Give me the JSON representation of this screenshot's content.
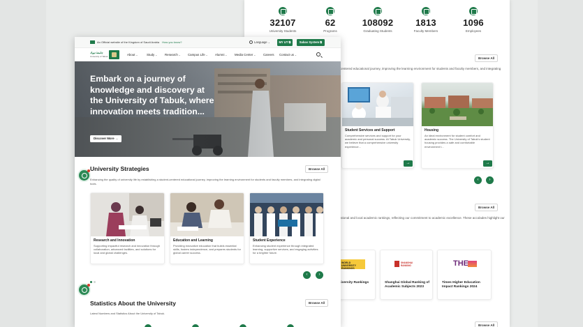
{
  "back_window": {
    "stats": [
      {
        "number": "32107",
        "label": "University Students",
        "icon": "graduation-cap-icon"
      },
      {
        "number": "62",
        "label": "Programs",
        "icon": "book-icon"
      },
      {
        "number": "108092",
        "label": "Graduating Students",
        "icon": "diploma-icon"
      },
      {
        "number": "1813",
        "label": "Faculty Members",
        "icon": "teacher-icon"
      },
      {
        "number": "1096",
        "label": "Employees",
        "icon": "briefcase-icon"
      }
    ],
    "browse_all_1": "Browse All",
    "intro_text": "centered educational journey, improving the learning environment for students and faculty members, and integrating",
    "cards": [
      {
        "title": "Student Services and Support",
        "description": "Comprehensive services and support for your academic and personal success. At Tabuk University, we believe that a comprehensive university experience..."
      },
      {
        "title": "Housing",
        "description": "An ideal environment for student comfort and academic success. The University of Tabuk's student housing provides a safe and comfortable environment t..."
      }
    ],
    "browse_all_2": "Browse All",
    "rankings_intro": "ational and local academic rankings, reflecting our commitment to academic excellence. These accolades highlight our",
    "rankings": [
      {
        "title": "University Rankings",
        "logo_text": "WORLD UNIVERSITY RANKINGS"
      },
      {
        "title": "Shanghai Global Ranking of Academic Subjects 2023",
        "logo_text": "SHANGHAI RANKING"
      },
      {
        "title": "Times Higher Education Impact Rankings 2024",
        "logo_text": "THE"
      }
    ],
    "browse_all_3": "Browse All"
  },
  "front_window": {
    "topbar": {
      "official_text": "An Official website of the Kingdom of Saudi Arabia",
      "know_link": "How you know?",
      "language": "Language",
      "my_ut": "MY UT",
      "sabas": "Sabas System"
    },
    "logo": {
      "arabic": "جامعة تبوك",
      "english": "University of Tabuk"
    },
    "nav": [
      {
        "label": "About",
        "has_dropdown": true
      },
      {
        "label": "Study",
        "has_dropdown": true
      },
      {
        "label": "Research",
        "has_dropdown": true
      },
      {
        "label": "Campus Life",
        "has_dropdown": true
      },
      {
        "label": "Alumni",
        "has_dropdown": true
      },
      {
        "label": "Media Center",
        "has_dropdown": true
      },
      {
        "label": "Careers",
        "has_dropdown": false
      },
      {
        "label": "Contact us",
        "has_dropdown": true
      }
    ],
    "hero": {
      "title": "Embark on a journey of knowledge and discovery at the University of Tabuk, where innovation meets tradition...",
      "button": "Discover More"
    },
    "strategies": {
      "title": "University Strategies",
      "browse": "Browse All",
      "subtitle": "Enhancing the quality of university life by establishing a student-centered educational journey, improving the learning environment for students and faculty members, and integrating digital tools.",
      "cards": [
        {
          "title": "Research and Innovation",
          "description": "Supporting impactful research and innovation through collaboration, advanced facilities, and solutions for local and global challenges."
        },
        {
          "title": "Education and Learning",
          "description": "Providing innovative education that builds essential skills, fosters independence, and prepares students for global career success."
        },
        {
          "title": "Student Experience",
          "description": "Enhancing student experience through integrated learning, supportive services, and engaging activities for a brighter future."
        }
      ]
    },
    "statistics": {
      "title": "Statistics About the University",
      "browse": "Browse All",
      "subtitle": "Latest Numbers and Statistics About the University of Tabuk."
    }
  },
  "colors": {
    "brand_green": "#1f7a4a",
    "background": "#e9ebea"
  }
}
